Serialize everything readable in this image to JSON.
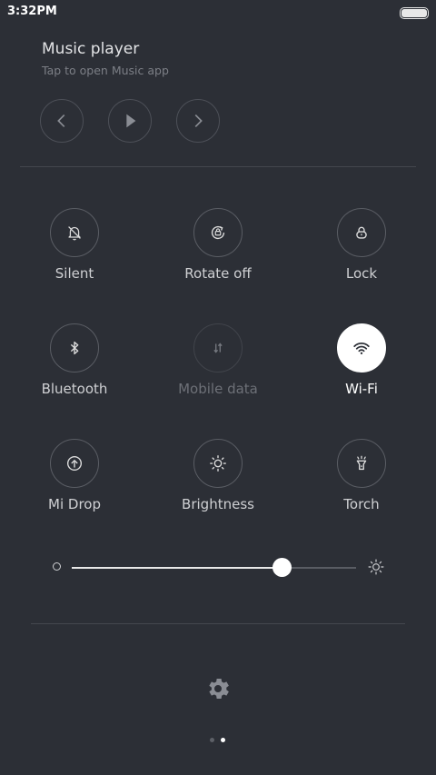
{
  "status_bar": {
    "time": "3:32PM"
  },
  "music": {
    "title": "Music player",
    "subtitle": "Tap to open Music app",
    "controls": [
      "previous-icon",
      "play-icon",
      "next-icon"
    ]
  },
  "toggles": [
    {
      "label": "Silent",
      "icon": "bell-off-icon",
      "state": "off"
    },
    {
      "label": "Rotate off",
      "icon": "rotate-lock-icon",
      "state": "off"
    },
    {
      "label": "Lock",
      "icon": "lock-icon",
      "state": "off"
    },
    {
      "label": "Bluetooth",
      "icon": "bluetooth-icon",
      "state": "off"
    },
    {
      "label": "Mobile data",
      "icon": "mobile-data-icon",
      "state": "disabled"
    },
    {
      "label": "Wi-Fi",
      "icon": "wifi-icon",
      "state": "on"
    },
    {
      "label": "Mi Drop",
      "icon": "mi-drop-icon",
      "state": "off"
    },
    {
      "label": "Brightness",
      "icon": "brightness-icon",
      "state": "off"
    },
    {
      "label": "Torch",
      "icon": "torch-icon",
      "state": "off"
    }
  ],
  "brightness": {
    "level": 0.74
  },
  "pager": {
    "pages": 2,
    "current": 2
  },
  "colors": {
    "background": "#2c2f36",
    "active": "#ffffff",
    "inactive_ring": "#5a5d64"
  }
}
